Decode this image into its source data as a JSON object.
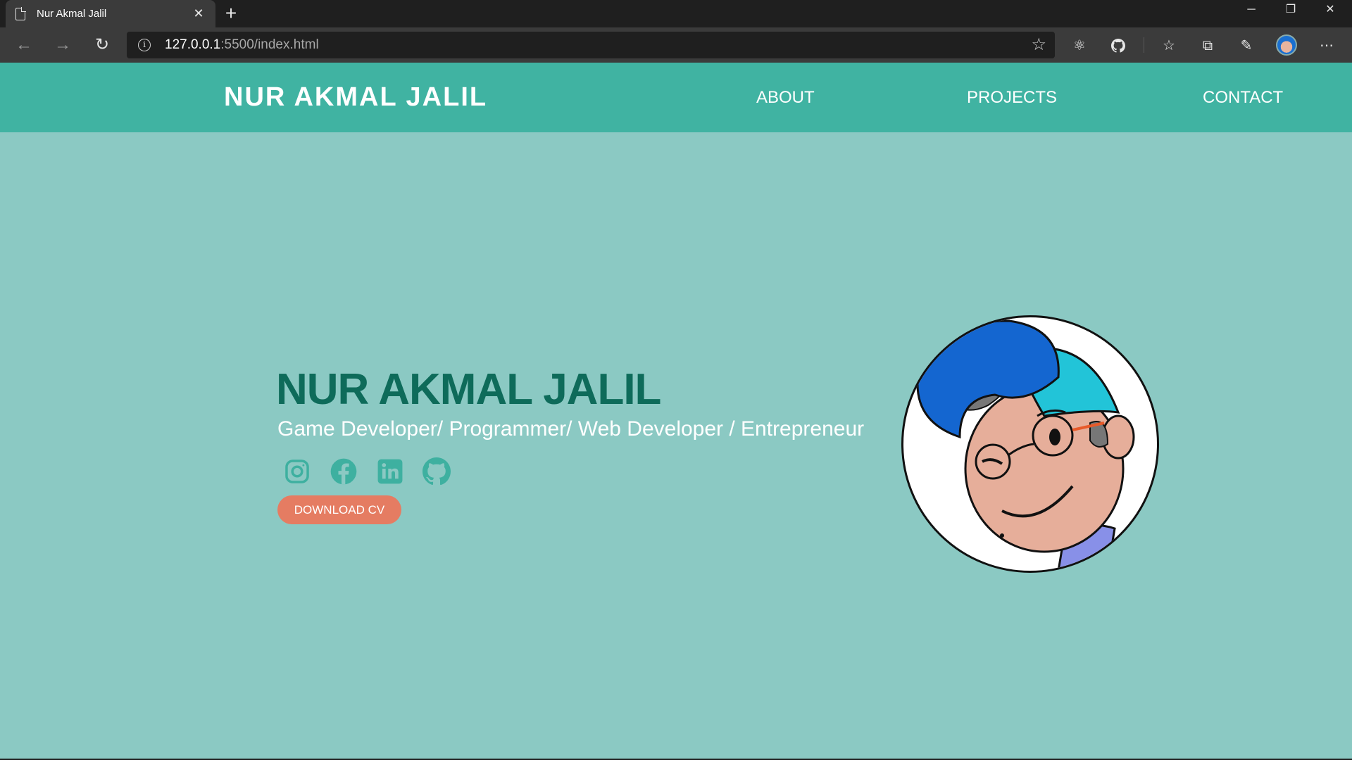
{
  "browser": {
    "tab_title": "Nur Akmal Jalil",
    "url_host": "127.0.0.1",
    "url_path": ":5500/index.html"
  },
  "site": {
    "brand": "NUR AKMAL JALIL",
    "nav": {
      "about": "ABOUT",
      "projects": "PROJECTS",
      "contact": "CONTACT"
    }
  },
  "hero": {
    "name": "NUR AKMAL JALIL",
    "subtitle": "Game Developer/ Programmer/ Web Developer / Entrepreneur",
    "socials": [
      "instagram-icon",
      "facebook-icon",
      "linkedin-icon",
      "github-icon"
    ],
    "cv_button": "DOWNLOAD CV"
  },
  "colors": {
    "page_bg": "#8bc9c3",
    "header_bg": "#40b3a2",
    "name_color": "#0e6b5a",
    "social_color": "#3eb0a0",
    "cv_button_bg": "#e57c62"
  }
}
